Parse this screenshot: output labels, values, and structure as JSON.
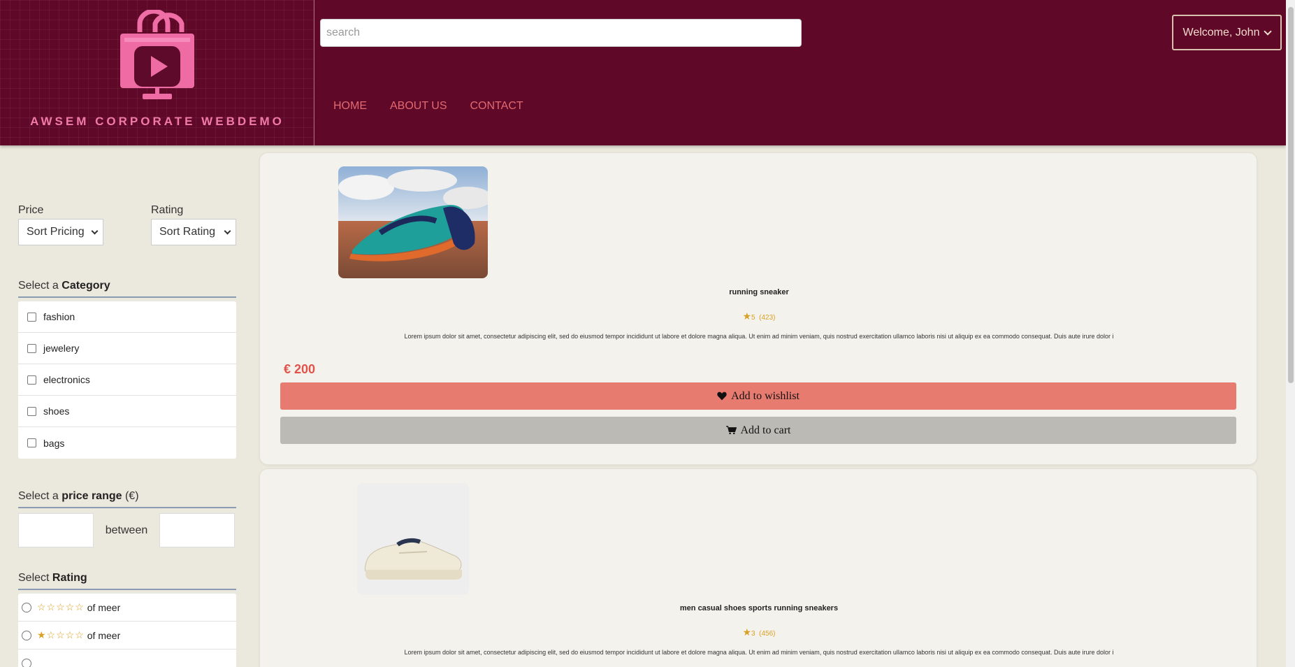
{
  "brand": {
    "name": "AWSEM CORPORATE WEBDEMO",
    "logo_icon": "shopping-bag-monitor-play-icon"
  },
  "search": {
    "placeholder": "search"
  },
  "user_menu": {
    "label": "Welcome, John"
  },
  "nav": {
    "home": "HOME",
    "about": "ABOUT US",
    "contact": "CONTACT"
  },
  "filters": {
    "price_label": "Price",
    "price_select": "Sort Pricing",
    "rating_label": "Rating",
    "rating_select": "Sort Rating",
    "category": {
      "prefix": "Select a ",
      "bold": "Category",
      "items": [
        {
          "label": "fashion"
        },
        {
          "label": "jewelery"
        },
        {
          "label": "electronics"
        },
        {
          "label": "shoes"
        },
        {
          "label": "bags"
        }
      ]
    },
    "price_range": {
      "prefix": "Select a ",
      "bold": "price range",
      "suffix": " (€)",
      "between": "between"
    },
    "rating": {
      "prefix": "Select ",
      "bold": "Rating",
      "items": [
        {
          "stars": "☆☆☆☆☆",
          "suffix": "of meer"
        },
        {
          "stars": "★☆☆☆☆",
          "suffix": "of meer"
        }
      ]
    }
  },
  "products": [
    {
      "name": "running sneaker",
      "rating": "5",
      "reviews": "(423)",
      "description": "Lorem ipsum dolor sit amet, consectetur adipiscing elit, sed do eiusmod tempor incididunt ut labore et dolore magna aliqua. Ut enim ad minim veniam, quis nostrud exercitation ullamco laboris nisi ut aliquip ex ea commodo consequat. Duis aute irure dolor i",
      "price": "€ 200",
      "wishlist_label": "Add to wishlist",
      "cart_label": "Add to cart"
    },
    {
      "name": "men casual shoes sports running sneakers",
      "rating": "3",
      "reviews": "(456)",
      "description": "Lorem ipsum dolor sit amet, consectetur adipiscing elit, sed do eiusmod tempor incididunt ut labore et dolore magna aliqua. Ut enim ad minim veniam, quis nostrud exercitation ullamco laboris nisi ut aliquip ex ea commodo consequat. Duis aute irure dolor i"
    }
  ],
  "colors": {
    "header_bg": "#600828",
    "accent_pink": "#f07aa8",
    "nav_link": "#e26a70",
    "price": "#e0534a",
    "wishlist_btn": "#e87b70",
    "cart_btn": "#bcbab5",
    "star": "#d9a124"
  }
}
